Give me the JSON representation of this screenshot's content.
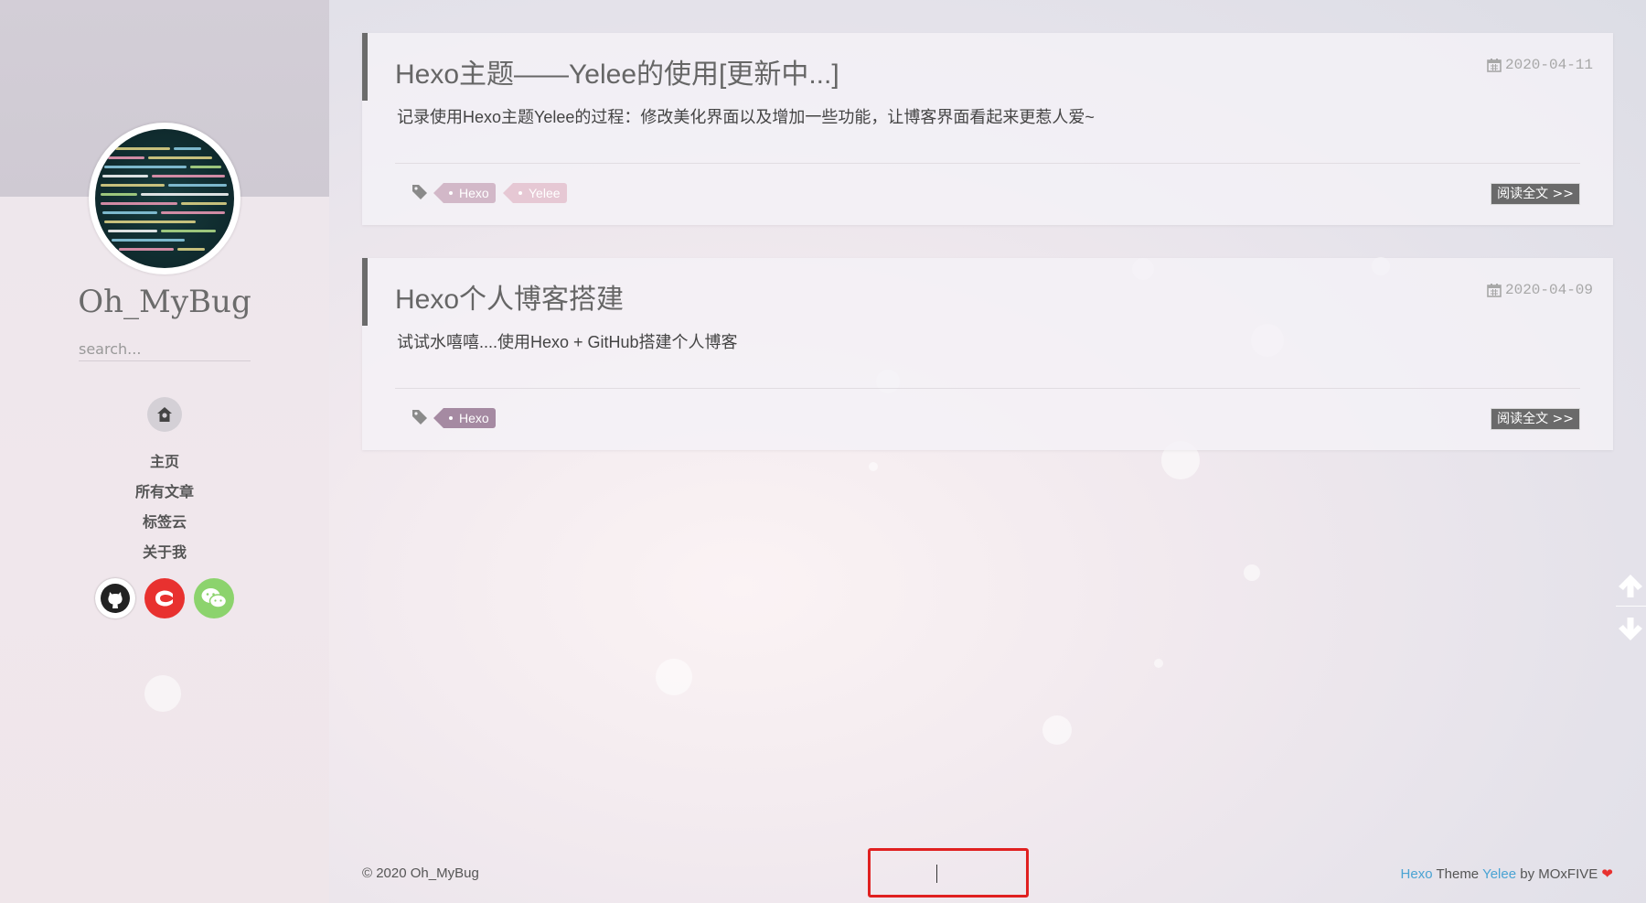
{
  "sidebar": {
    "site_name": "Oh_MyBug",
    "search_placeholder": "search...",
    "nav_items": [
      {
        "label": "主页"
      },
      {
        "label": "所有文章"
      },
      {
        "label": "标签云"
      },
      {
        "label": "关于我"
      }
    ],
    "social": [
      {
        "name": "github-icon"
      },
      {
        "name": "csdn-icon"
      },
      {
        "name": "wechat-icon"
      }
    ]
  },
  "posts": [
    {
      "title": "Hexo主题——Yelee的使用[更新中...]",
      "date": "2020-04-11",
      "excerpt": "记录使用Hexo主题Yelee的过程：修改美化界面以及增加一些功能，让博客界面看起来更惹人爱~",
      "tags": [
        {
          "label": "Hexo",
          "color": "#d2b8c8"
        },
        {
          "label": "Yelee",
          "color": "#e6c8d4"
        }
      ],
      "read_more": "阅读全文 >>"
    },
    {
      "title": "Hexo个人博客搭建",
      "date": "2020-04-09",
      "excerpt": "试试水嘻嘻....使用Hexo + GitHub搭建个人博客",
      "tags": [
        {
          "label": "Hexo",
          "color": "#a58aa2"
        }
      ],
      "read_more": "阅读全文 >>"
    }
  ],
  "footer": {
    "copyright": "© 2020 Oh_MyBug",
    "hexo": "Hexo",
    "theme_word": "Theme",
    "yelee": "Yelee",
    "by": "by MOxFIVE",
    "heart": "❤"
  },
  "colors": {
    "accent_link": "#4aa3d3",
    "heart": "#e8312f",
    "highlight": "#e02020"
  }
}
